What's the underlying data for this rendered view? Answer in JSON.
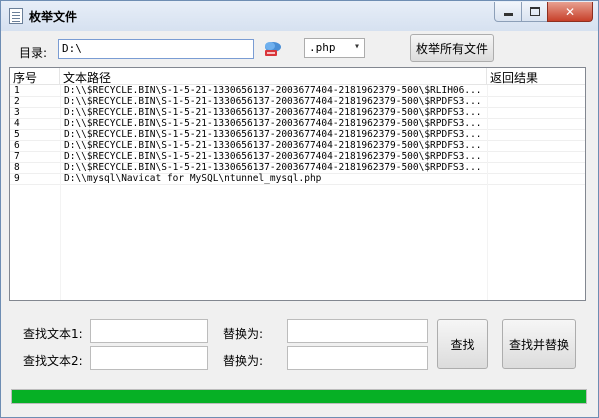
{
  "window": {
    "title": "枚举文件",
    "icon": "document-icon"
  },
  "toolbar": {
    "dir_label": "目录:",
    "dir_value": "D:\\",
    "extension": ".php",
    "enumerate_label": "枚举所有文件"
  },
  "table": {
    "columns": [
      "序号",
      "文本路径",
      "返回结果"
    ],
    "rows": [
      {
        "num": "1",
        "path": "D:\\\\$RECYCLE.BIN\\S-1-5-21-1330656137-2003677404-2181962379-500\\$RLIH06...",
        "result": ""
      },
      {
        "num": "2",
        "path": "D:\\\\$RECYCLE.BIN\\S-1-5-21-1330656137-2003677404-2181962379-500\\$RPDFS3...",
        "result": ""
      },
      {
        "num": "3",
        "path": "D:\\\\$RECYCLE.BIN\\S-1-5-21-1330656137-2003677404-2181962379-500\\$RPDFS3...",
        "result": ""
      },
      {
        "num": "4",
        "path": "D:\\\\$RECYCLE.BIN\\S-1-5-21-1330656137-2003677404-2181962379-500\\$RPDFS3...",
        "result": ""
      },
      {
        "num": "5",
        "path": "D:\\\\$RECYCLE.BIN\\S-1-5-21-1330656137-2003677404-2181962379-500\\$RPDFS3...",
        "result": ""
      },
      {
        "num": "6",
        "path": "D:\\\\$RECYCLE.BIN\\S-1-5-21-1330656137-2003677404-2181962379-500\\$RPDFS3...",
        "result": ""
      },
      {
        "num": "7",
        "path": "D:\\\\$RECYCLE.BIN\\S-1-5-21-1330656137-2003677404-2181962379-500\\$RPDFS3...",
        "result": ""
      },
      {
        "num": "8",
        "path": "D:\\\\$RECYCLE.BIN\\S-1-5-21-1330656137-2003677404-2181962379-500\\$RPDFS3...",
        "result": ""
      },
      {
        "num": "9",
        "path": "D:\\\\mysql\\Navicat for MySQL\\ntunnel_mysql.php",
        "result": ""
      }
    ]
  },
  "search": {
    "find1_label": "查找文本1:",
    "find1_value": "",
    "find2_label": "查找文本2:",
    "find2_value": "",
    "replace1_label": "替换为:",
    "replace1_value": "",
    "replace2_label": "替换为:",
    "replace2_value": "",
    "find_button": "查找",
    "find_replace_button": "查找并替换"
  },
  "progress": {
    "fraction": 1.0,
    "color": "#06b025"
  },
  "colors": {
    "title_bg": "#d6e1f0",
    "close_button": "#c7402a",
    "input_border": "#7a9cd3"
  }
}
